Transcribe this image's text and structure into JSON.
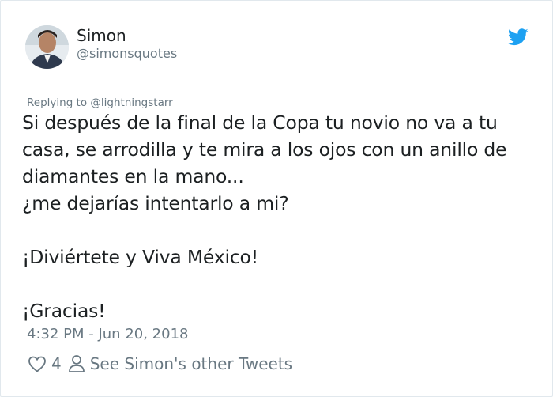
{
  "tweet": {
    "author_name": "Simon",
    "author_handle": "@simonsquotes",
    "replying_to": "Replying to @lightningstarr",
    "lines": [
      "Si después de la final de la Copa tu novio no va a tu",
      "casa, se arrodilla y te mira a los ojos con un anillo de",
      "diamantes en la mano...",
      "¿me dejarías intentarlo a mi?",
      "",
      "¡Diviértete y Viva México!",
      "",
      "¡Gracias!"
    ],
    "timestamp": "4:32 PM - Jun 20, 2018",
    "like_count": "4",
    "other_tweets_label": "See Simon's other Tweets"
  },
  "icons": {
    "brand": "twitter-bird-icon",
    "like": "heart-icon",
    "profile": "person-icon"
  },
  "colors": {
    "brand_blue": "#1da1f2",
    "text_primary": "#1c2022",
    "text_secondary": "#697882",
    "border": "#e1e8ed"
  }
}
